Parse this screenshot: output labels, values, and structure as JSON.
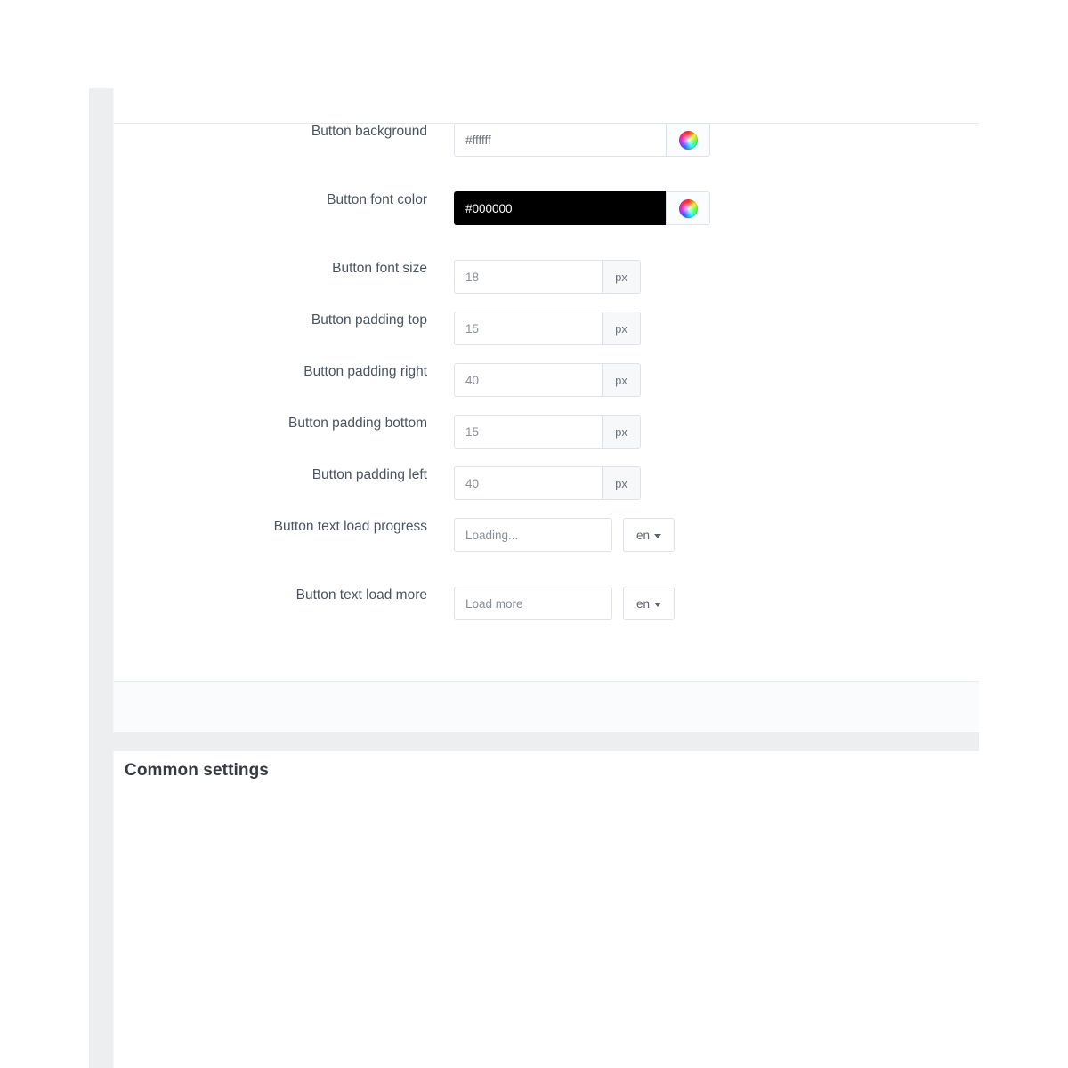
{
  "panel": {
    "footer_label": "",
    "next_section_title": "Common settings"
  },
  "form": {
    "rows": [
      {
        "label": "Button background",
        "kind": "color",
        "value": "#ffffff",
        "swatch": "#ffffff",
        "picker_icon": "color-wheel-icon"
      },
      {
        "label": "Button font color",
        "kind": "color",
        "value": "#000000",
        "swatch": "#000000",
        "picker_icon": "color-wheel-icon"
      },
      {
        "label": "Button font size",
        "kind": "number",
        "value": "18",
        "unit": "px"
      },
      {
        "label": "Button padding top",
        "kind": "number",
        "value": "15",
        "unit": "px"
      },
      {
        "label": "Button padding right",
        "kind": "number",
        "value": "40",
        "unit": "px"
      },
      {
        "label": "Button padding bottom",
        "kind": "number",
        "value": "15",
        "unit": "px"
      },
      {
        "label": "Button padding left",
        "kind": "number",
        "value": "40",
        "unit": "px"
      },
      {
        "label": "Button text load progress",
        "kind": "text",
        "value": "Loading...",
        "lang": "en"
      },
      {
        "label": "Button text load more",
        "kind": "text",
        "value": "Load more",
        "lang": "en"
      }
    ]
  },
  "colors": {
    "page_background": "#eceeef",
    "card_background": "#ffffff",
    "label_text": "#4a5561",
    "input_border": "#dfe3e8",
    "addon_background": "#f6f8fa",
    "value_text": "#8a9099",
    "dark_field_background": "#000000",
    "dark_field_text": "#ffffff"
  }
}
